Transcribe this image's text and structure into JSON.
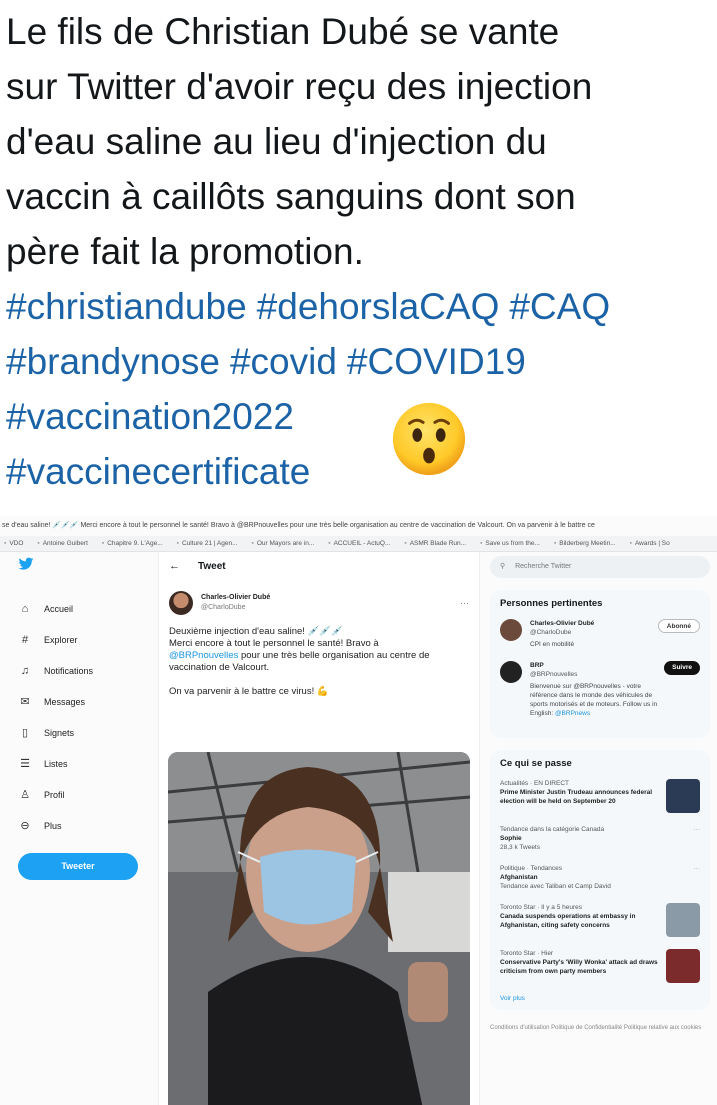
{
  "caption": {
    "lines": [
      "Le fils de Christian Dubé se vante",
      "sur Twitter d'avoir reçu des injection",
      "d'eau saline au lieu d'injection du",
      "vaccin à caillôts sanguins dont son",
      "père fait la promotion."
    ],
    "hashtags": [
      "#christiandube",
      "#dehorslaCAQ",
      "#CAQ",
      "#brandynose",
      "#covid",
      "#COVID19",
      "#vaccination2022",
      "#vaccinecertificate"
    ],
    "emoji": "hushed-face-emoji"
  },
  "browser": {
    "title": "se d'eau saline! 💉💉💉 Merci encore à tout le personnel le santé! Bravo à @BRPnouvelles pour une très belle organisation au centre de vaccination de Valcourt. On va parvenir à le battre ce",
    "bookmarks": [
      "VDO",
      "Antoine Guibert",
      "Chapitre 9. L'Age...",
      "Culture 21 | Agen...",
      "Our Mayors are in...",
      "ACCUEIL - ActuQ...",
      "ASMR Blade Run...",
      "Save us from the...",
      "Bilderberg Meetin...",
      "Awards | So"
    ]
  },
  "nav": {
    "items": [
      {
        "label": "Accueil",
        "icon": "home-icon",
        "glyph": "⌂"
      },
      {
        "label": "Explorer",
        "icon": "hashtag-icon",
        "glyph": "#"
      },
      {
        "label": "Notifications",
        "icon": "bell-icon",
        "glyph": "♫"
      },
      {
        "label": "Messages",
        "icon": "envelope-icon",
        "glyph": "✉"
      },
      {
        "label": "Signets",
        "icon": "bookmark-icon",
        "glyph": "▯"
      },
      {
        "label": "Listes",
        "icon": "list-icon",
        "glyph": "☰"
      },
      {
        "label": "Profil",
        "icon": "user-icon",
        "glyph": "♙"
      },
      {
        "label": "Plus",
        "icon": "more-circle-icon",
        "glyph": "⊖"
      }
    ],
    "tweet_button": "Tweeter"
  },
  "tweet": {
    "header": "Tweet",
    "back": "←",
    "author_name": "Charles-Olivier Dubé",
    "author_handle": "@CharloDube",
    "more": "···",
    "text_line1": "Deuxième injection d'eau saline! 💉💉💉",
    "text_line2": "Merci encore à tout le personnel le santé! Bravo à",
    "mention": "@BRPnouvelles",
    "text_line3": "pour une très belle organisation au centre de vaccination de Valcourt.",
    "text_line4": "On va parvenir à le battre ce virus! 💪"
  },
  "sidebar": {
    "search_placeholder": "Recherche Twitter",
    "people_title": "Personnes pertinentes",
    "people": [
      {
        "name": "Charles-Olivier Dubé",
        "handle": "@CharloDube",
        "bio": "CPI en mobilité",
        "button": "Abonné",
        "color": "#6b4a3c"
      },
      {
        "name": "BRP",
        "handle": "@BRPnouvelles",
        "bio": "Bienvenue sur @BRPnouvelles - votre référence dans le monde des véhicules de sports motorisés et de moteurs. Follow us in English:",
        "bio_link": "@BRPnews",
        "button": "Suivre",
        "color": "#222222"
      }
    ],
    "trends_title": "Ce qui se passe",
    "trends": [
      {
        "context": "Actualités · EN DIRECT",
        "title": "Prime Minister Justin Trudeau announces federal election will be held on September 20",
        "meta": "",
        "thumb": "#2b3a55"
      },
      {
        "context": "Tendance dans la catégorie Canada",
        "title": "Sophie",
        "meta": "28,3 k Tweets",
        "thumb": ""
      },
      {
        "context": "Politique · Tendances",
        "title": "Afghanistan",
        "meta": "Tendance avec Taliban et Camp David",
        "thumb": ""
      },
      {
        "context": "Toronto Star · Il y a 5 heures",
        "title": "Canada suspends operations at embassy in Afghanistan, citing safety concerns",
        "meta": "",
        "thumb": "#8a9aa6"
      },
      {
        "context": "Toronto Star · Hier",
        "title": "Conservative Party's 'Willy Wonka' attack ad draws criticism from own party members",
        "meta": "",
        "thumb": "#7b2b2b"
      }
    ],
    "show_more": "Voir plus",
    "footer": "Conditions d'utilisation   Politique de Confidentialité   Politique relative aux cookies"
  }
}
